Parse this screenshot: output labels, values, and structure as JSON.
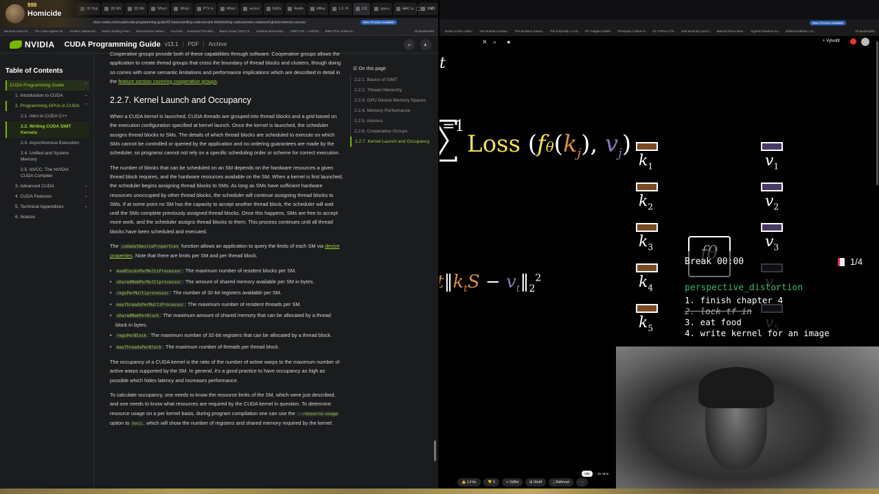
{
  "stream": {
    "viewer_count": "999",
    "streamer": "Homicide"
  },
  "left_browser": {
    "tabs": [
      "(8) Hyp",
      "(8) Wri",
      "(8) Wri",
      "What i",
      "What i",
      "PTX in",
      "What i",
      "vectori",
      "GitHu",
      "Redm",
      "diffrac",
      "1.2. Pr",
      "2.2.",
      "gpu-u",
      "GPC tu",
      "SIMD"
    ],
    "url": "docs.nvidia.com/cuda/cuda-programming-guide/02-basics/writing-cuda-kernels.html#writing-cuda-kernels-coalesced-global-memory-access",
    "incognito": "Incognito (2)",
    "new_chrome": "New Chrome available",
    "bookmarks": [
      "Become more hu...",
      "The Case Against W...",
      "Alt-Idee | Balanced...",
      "Watch Smiling Fram...",
      "Monochrome Seaso...",
      "YouTube",
      "Download The Blid...",
      "Black Clover (2017) S...",
      "Kvliteral alchemistic...",
      "CREY ICE + LARGE...",
      "Bitter Plus Violent R...",
      "All Bookmarks"
    ]
  },
  "site": {
    "brand": "NVIDIA",
    "guide_title": "CUDA Programming Guide",
    "version": "v13.1",
    "pdf": "PDF",
    "archive": "Archive"
  },
  "toc": {
    "title": "Table of Contents",
    "items": [
      {
        "label": "CUDA Programming Guide",
        "level": 0
      },
      {
        "label": "1. Introduction to CUDA",
        "level": 1
      },
      {
        "label": "2. Programming GPUs in CUDA",
        "level": 1
      },
      {
        "label": "2.1. Intro to CUDA C++",
        "level": 2
      },
      {
        "label": "2.2. Writing CUDA SIMT Kernels",
        "level": 2
      },
      {
        "label": "2.3. Asynchronous Execution",
        "level": 2
      },
      {
        "label": "2.4. Unified and System Memory",
        "level": 2
      },
      {
        "label": "2.5. NVCC: The NVIDIA CUDA Compiler",
        "level": 2
      },
      {
        "label": "3. Advanced CUDA",
        "level": 1
      },
      {
        "label": "4. CUDA Features",
        "level": 1
      },
      {
        "label": "5. Technical Appendices",
        "level": 1
      },
      {
        "label": "6. Notices",
        "level": 1
      }
    ]
  },
  "on_this_page": {
    "title": "On this page",
    "items": [
      "2.2.1. Basics of SIMT",
      "2.2.2. Thread Hierarchy",
      "2.2.3. GPU Device Memory Spaces",
      "2.2.4. Memory Performance",
      "2.2.5. Atomics",
      "2.2.6. Cooperative Groups",
      "2.2.7. Kernel Launch and Occupancy"
    ]
  },
  "content": {
    "intro_p": "Cooperative groups provide both of these capabilities through software. Cooperative groups allows the application to create thread groups that cross the boundary of thread blocks and clusters, though doing so comes with some semantic limitations and performance implications which are described in detail in the",
    "intro_link": "feature section covering cooperative groups",
    "heading": "2.2.7. Kernel Launch and Occupancy",
    "p1": "When a CUDA kernel is launched, CUDA threads are grouped into thread blocks and a grid based on the execution configuration specified at kernel launch. Once the kernel is launched, the scheduler assigns thread blocks to SMs. The details of which thread blocks are scheduled to execute on which SMs cannot be controlled or queried by the application and no ordering guarantees are made by the scheduler, so programs cannot not rely on a specific scheduling order or scheme for correct execution.",
    "p2": "The number of blocks that can be scheduled on an SM depends on the hardware resources a given thread block requires, and the hardware resources available on the SM. When a kernel is first launched, the scheduler begins assigning thread blocks to SMs. As long as SMs have sufficient hardware resources unoccupied by other thread blocks, the scheduler will continue assigning thread blocks to SMs. If at some point no SM has the capacity to accept another thread block, the scheduler will wait until the SMs complete previously assigned thread blocks. Once this happens, SMs are free to accept more work, and the scheduler assigns thread blocks to them. This process continues until all thread blocks have been scheduled and executed.",
    "p3_a": "The",
    "p3_code": "cudaGetDeviceProperties",
    "p3_b": "function allows an application to query the limits of each SM via",
    "p3_link": "device properties",
    "p3_c": ". Note that there are limits per SM and per thread block.",
    "bullets": [
      {
        "code": "maxBlocksPerMultiProcessor",
        "text": ": The maximum number of resident blocks per SM."
      },
      {
        "code": "sharedMemPerMultiprocessor",
        "text": ": The amount of shared memory available per SM in bytes."
      },
      {
        "code": "regsPerMultiprocessor",
        "text": ": The number of 32-bit registers available per SM."
      },
      {
        "code": "maxThreadsPerMultiProcessor",
        "text": ": The maximum number of resident threads per SM."
      },
      {
        "code": "sharedMemPerBlock",
        "text": ": The maximum amount of shared memory that can be allocated by a thread block in bytes."
      },
      {
        "code": "regsPerBlock",
        "text": ": The maximum number of 32-bit registers that can be allocated by a thread block."
      },
      {
        "code": "maxThreadsPerBlock",
        "text": ": The maximum number of threads per thread block."
      }
    ],
    "p4": "The occupancy of a CUDA kernel is the ratio of the number of active warps to the maximum number of active warps supported by the SM. In general, it's a good practice to have occupancy as high as possible which hides latency and increases performance.",
    "p5_a": "To calculate occupancy, one needs to know the resource limits of the SM, which were just described, and one needs to know what resources are required by the CUDA kernel in question. To determine resource usage on a per kernel basis, during program compilation one can use the",
    "p5_code1": "--resource-usage",
    "p5_b": "option to",
    "p5_code2": "nvcc",
    "p5_c": ", which will show the number of registers and shared memory required by the kernel."
  },
  "right_browser": {
    "new_chrome": "New Chrome available",
    "bookmarks": [
      "Notes on the Collec...",
      "The Brothers Karam...",
      "The Brothers Karam...",
      "The Polymath: A Cul...",
      "PC Adapter reduki...",
      "Photopea | Online P...",
      "Clr x DPH s Čín...",
      "Red Book By Carl G...",
      "Metroid Prime Rem...",
      "Hyper5 Pukeline Pa...",
      "Skilled Realtime | Vo...",
      "All Bookmarks"
    ],
    "create_label": "Vytvořit"
  },
  "video": {
    "sigma_top": "t",
    "sigma_bottom": "=1",
    "loss_word": "Loss",
    "keys": [
      "k1",
      "k2",
      "k3",
      "k4",
      "k5"
    ],
    "values": [
      "v1",
      "v2",
      "v3",
      "v4",
      "v5"
    ],
    "f_label": "fθ",
    "key_color": "#7a4a22",
    "value_color": "#4a3a66",
    "formula_color": "#f3df5a"
  },
  "overlay": {
    "break_label": "Break 00:00",
    "page_indicator": "1/4",
    "todo_title": "perspective_distortion",
    "todos": [
      {
        "text": "1. finish chapter 4",
        "done": false
      },
      {
        "text": "2. lock tf in",
        "done": true
      },
      {
        "text": "3. eat food",
        "done": false
      },
      {
        "text": "4. write kernel for an image",
        "done": false
      }
    ]
  },
  "yt_actions": {
    "likes": "1,4 tis.",
    "dislike_count": "5",
    "share": "Sdílet",
    "save": "Uložit",
    "download": "Stáhnout",
    "more": "···",
    "chip_all": "Vše",
    "chip_series": "Ze série"
  }
}
